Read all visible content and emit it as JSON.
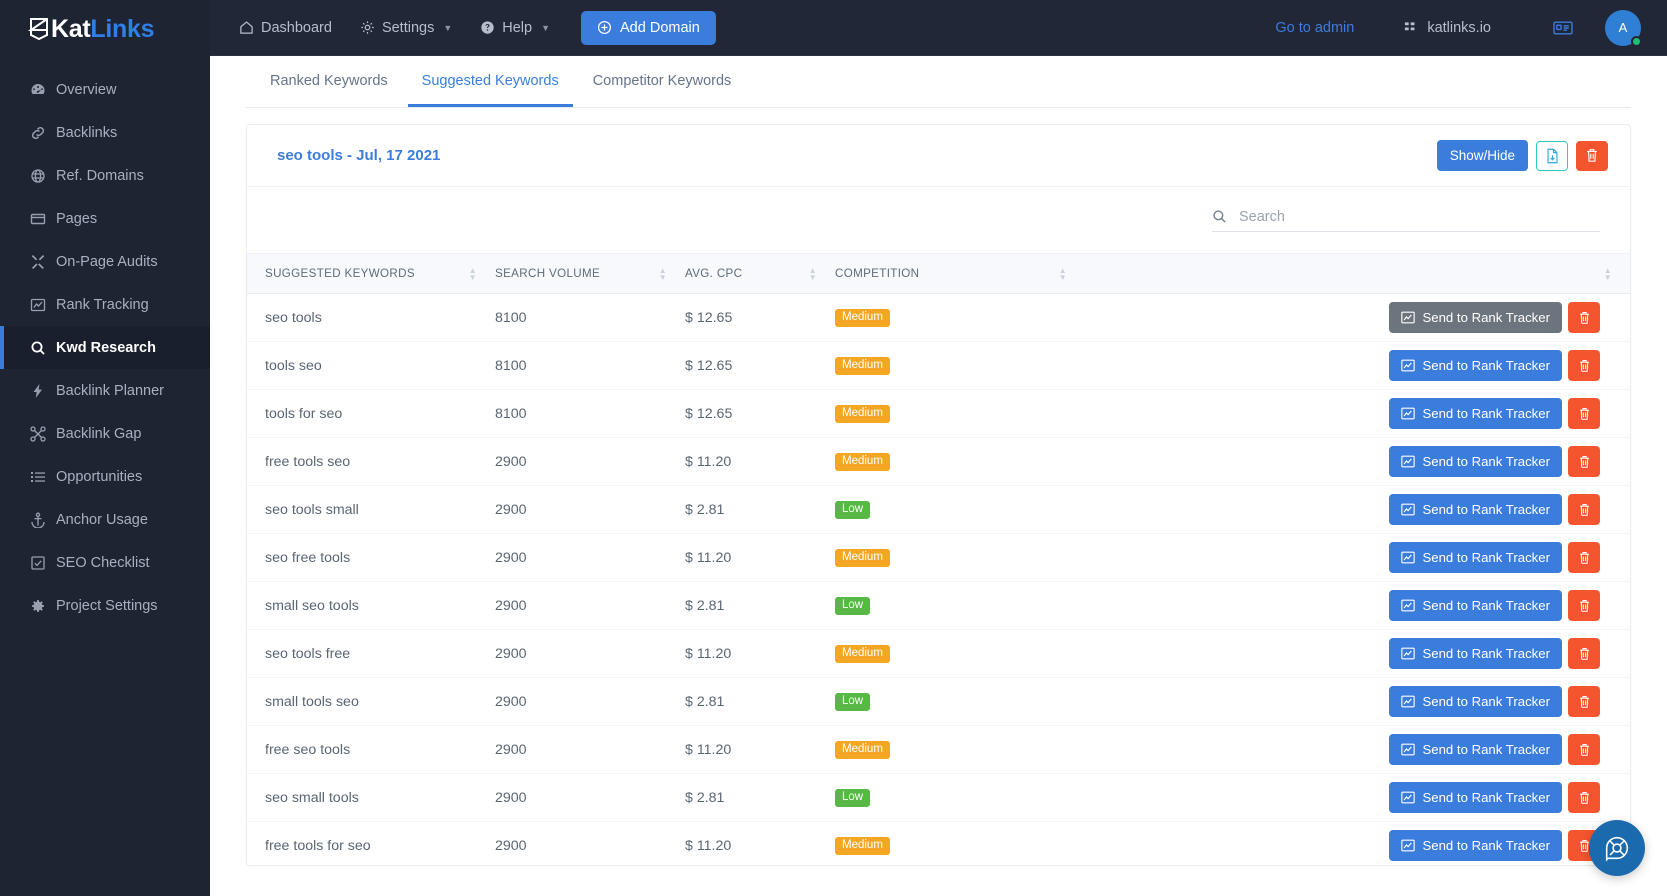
{
  "brand": {
    "word1": "Kat",
    "word2": "Links",
    "icon": "katlinks-logo-icon"
  },
  "sidebar": {
    "items": [
      {
        "label": "Overview",
        "icon": "gauge-icon"
      },
      {
        "label": "Backlinks",
        "icon": "link-icon"
      },
      {
        "label": "Ref. Domains",
        "icon": "globe-icon"
      },
      {
        "label": "Pages",
        "icon": "window-icon"
      },
      {
        "label": "On-Page Audits",
        "icon": "tools-icon"
      },
      {
        "label": "Rank Tracking",
        "icon": "chart-line-icon"
      },
      {
        "label": "Kwd Research",
        "icon": "search-icon",
        "active": true
      },
      {
        "label": "Backlink Planner",
        "icon": "bolt-icon"
      },
      {
        "label": "Backlink Gap",
        "icon": "network-icon"
      },
      {
        "label": "Opportunities",
        "icon": "list-icon"
      },
      {
        "label": "Anchor Usage",
        "icon": "anchor-icon"
      },
      {
        "label": "SEO Checklist",
        "icon": "check-square-icon"
      },
      {
        "label": "Project Settings",
        "icon": "gear-icon"
      }
    ]
  },
  "topbar": {
    "dashboard": "Dashboard",
    "settings": "Settings",
    "help": "Help",
    "add_domain": "Add Domain",
    "go_to_admin": "Go to admin",
    "site_name": "katlinks.io",
    "avatar_initial": "A"
  },
  "tabs": [
    {
      "label": "Ranked Keywords",
      "active": false
    },
    {
      "label": "Suggested Keywords",
      "active": true
    },
    {
      "label": "Competitor Keywords",
      "active": false
    }
  ],
  "card": {
    "title": "seo tools - Jul, 17 2021",
    "show_hide_label": "Show/Hide",
    "export_icon": "file-export-icon",
    "delete_icon": "trash-icon"
  },
  "search": {
    "placeholder": "Search",
    "value": "",
    "icon": "search-icon"
  },
  "table": {
    "columns": [
      "SUGGESTED KEYWORDS",
      "SEARCH VOLUME",
      "AVG. CPC",
      "COMPETITION",
      ""
    ],
    "row_action_label": "Send to Rank Tracker",
    "row_action_icon": "chart-line-icon",
    "row_delete_icon": "trash-icon",
    "rows": [
      {
        "keyword": "seo tools",
        "volume": "8100",
        "cpc": "$ 12.65",
        "competition": "Medium",
        "competition_level": "medium",
        "action_hovered": true
      },
      {
        "keyword": "tools seo",
        "volume": "8100",
        "cpc": "$ 12.65",
        "competition": "Medium",
        "competition_level": "medium",
        "action_hovered": false
      },
      {
        "keyword": "tools for seo",
        "volume": "8100",
        "cpc": "$ 12.65",
        "competition": "Medium",
        "competition_level": "medium",
        "action_hovered": false
      },
      {
        "keyword": "free tools seo",
        "volume": "2900",
        "cpc": "$ 11.20",
        "competition": "Medium",
        "competition_level": "medium",
        "action_hovered": false
      },
      {
        "keyword": "seo tools small",
        "volume": "2900",
        "cpc": "$ 2.81",
        "competition": "Low",
        "competition_level": "low",
        "action_hovered": false
      },
      {
        "keyword": "seo free tools",
        "volume": "2900",
        "cpc": "$ 11.20",
        "competition": "Medium",
        "competition_level": "medium",
        "action_hovered": false
      },
      {
        "keyword": "small seo tools",
        "volume": "2900",
        "cpc": "$ 2.81",
        "competition": "Low",
        "competition_level": "low",
        "action_hovered": false
      },
      {
        "keyword": "seo tools free",
        "volume": "2900",
        "cpc": "$ 11.20",
        "competition": "Medium",
        "competition_level": "medium",
        "action_hovered": false
      },
      {
        "keyword": "small tools seo",
        "volume": "2900",
        "cpc": "$ 2.81",
        "competition": "Low",
        "competition_level": "low",
        "action_hovered": false
      },
      {
        "keyword": "free seo tools",
        "volume": "2900",
        "cpc": "$ 11.20",
        "competition": "Medium",
        "competition_level": "medium",
        "action_hovered": false
      },
      {
        "keyword": "seo small tools",
        "volume": "2900",
        "cpc": "$ 2.81",
        "competition": "Low",
        "competition_level": "low",
        "action_hovered": false
      },
      {
        "keyword": "free tools for seo",
        "volume": "2900",
        "cpc": "$ 11.20",
        "competition": "Medium",
        "competition_level": "medium",
        "action_hovered": false
      }
    ]
  },
  "support_fab": {
    "icon": "lifebuoy-icon"
  },
  "colors": {
    "accent": "#3b7ddd",
    "sidebar_bg": "#1f2433",
    "topbar_bg": "#222737",
    "danger": "#f4542e",
    "medium": "#f5a623",
    "low": "#57b846"
  }
}
